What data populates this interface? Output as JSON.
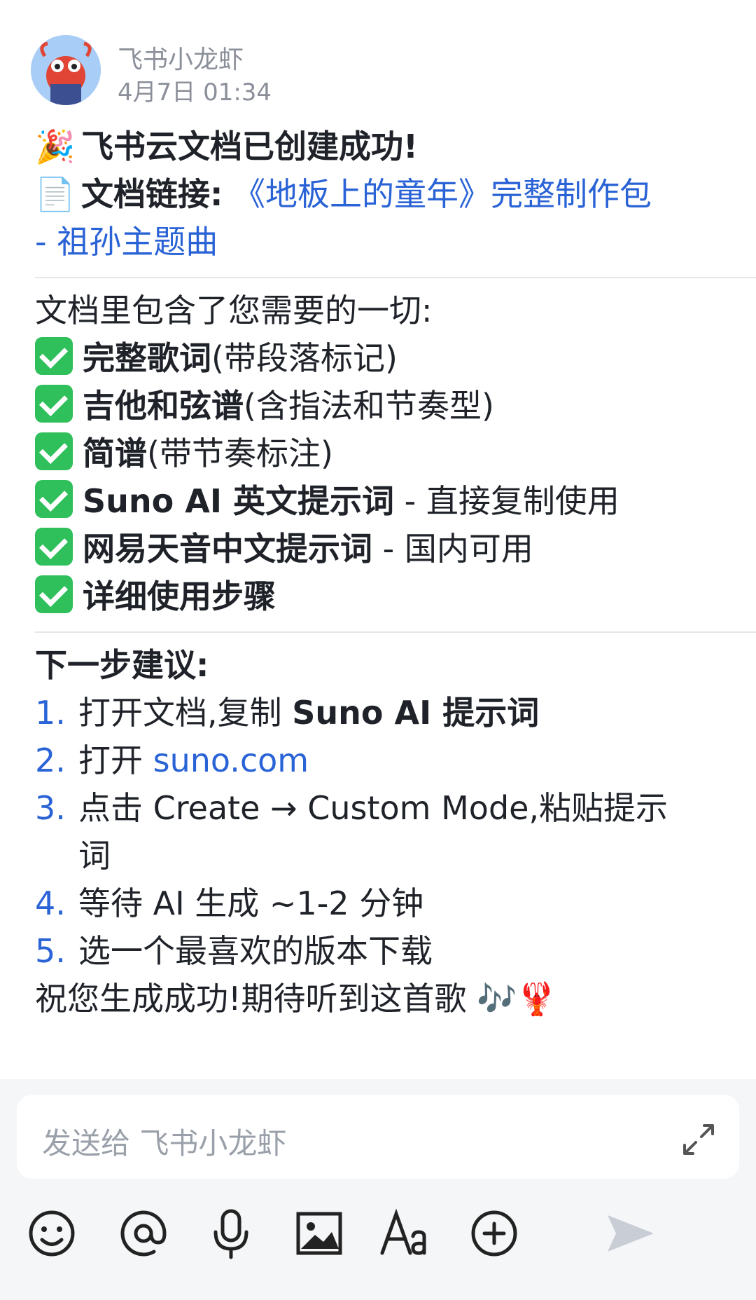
{
  "header": {
    "sender": "飞书小龙虾",
    "time": "4月7日 01:34"
  },
  "message": {
    "title_emoji": "🎉",
    "title": "飞书云文档已创建成功!",
    "doc_emoji": "📄",
    "doc_label": "文档链接:",
    "doc_link_line1": "《地板上的童年》完整制作包",
    "doc_link_line2": "- 祖孙主题曲",
    "intro": "文档里包含了您需要的一切:",
    "checklist": [
      {
        "bold": "完整歌词",
        "rest": "(带段落标记)"
      },
      {
        "bold": "吉他和弦谱",
        "rest": "(含指法和节奏型)"
      },
      {
        "bold": "简谱",
        "rest": "(带节奏标注)"
      },
      {
        "bold": "Suno AI 英文提示词",
        "rest": " - 直接复制使用"
      },
      {
        "bold": "网易天音中文提示词",
        "rest": " - 国内可用"
      },
      {
        "bold": "详细使用步骤",
        "rest": ""
      }
    ],
    "next_title": "下一步建议:",
    "steps": [
      {
        "num": "1.",
        "pre": "打开文档,复制 ",
        "bold": "Suno AI 提示词",
        "link": ""
      },
      {
        "num": "2.",
        "pre": "打开 ",
        "bold": "",
        "link": "suno.com"
      },
      {
        "num": "3.",
        "pre": "点击 Create → Custom Mode,粘贴提示",
        "cont": "词"
      },
      {
        "num": "4.",
        "pre": "等待 AI 生成 ~1-2 分钟"
      },
      {
        "num": "5.",
        "pre": "选一个最喜欢的版本下载"
      }
    ],
    "closing": "祝您生成成功!期待听到这首歌 🎶🦞"
  },
  "composer": {
    "placeholder": "发送给 飞书小龙虾"
  },
  "toolbar": {
    "icons": [
      "emoji-icon",
      "mention-icon",
      "microphone-icon",
      "image-icon",
      "text-format-icon",
      "add-icon",
      "send-icon"
    ]
  },
  "colors": {
    "link": "#2a63d6",
    "check": "#2fbf5b",
    "muted": "#8a8f99"
  }
}
